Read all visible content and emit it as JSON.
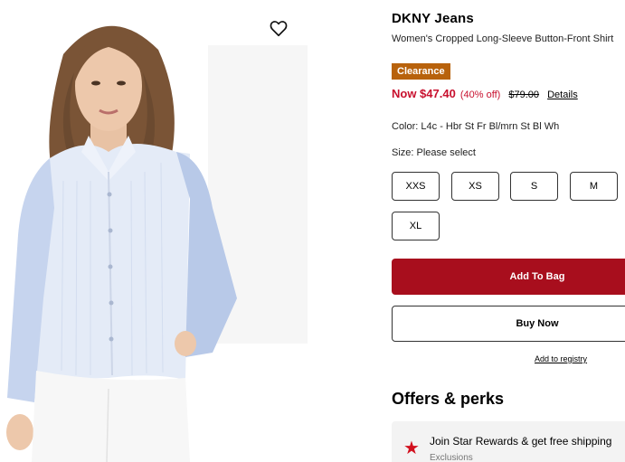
{
  "product": {
    "brand": "DKNY Jeans",
    "title": "Women's Cropped Long-Sleeve Button-Front Shirt",
    "badge": "Clearance",
    "wishlist_icon": "heart-icon"
  },
  "price": {
    "now": "Now $47.40",
    "discount": "(40% off)",
    "original": "$79.00",
    "details": "Details"
  },
  "color": {
    "label": "Color: L4c - Hbr St Fr Bl/mrn St Bl Wh"
  },
  "size": {
    "label": "Size: Please select",
    "options": [
      "XXS",
      "XS",
      "S",
      "M",
      "XL"
    ]
  },
  "actions": {
    "add_to_bag": "Add To Bag",
    "buy_now": "Buy Now",
    "registry": "Add to registry"
  },
  "offers": {
    "heading": "Offers & perks",
    "card_title": "Join Star Rewards & get free shipping",
    "card_sub": "Exclusions",
    "icon": "star-icon"
  },
  "colors": {
    "accent_red": "#a80e1d",
    "price_red": "#c8102e",
    "clearance_badge": "#b8620c"
  }
}
